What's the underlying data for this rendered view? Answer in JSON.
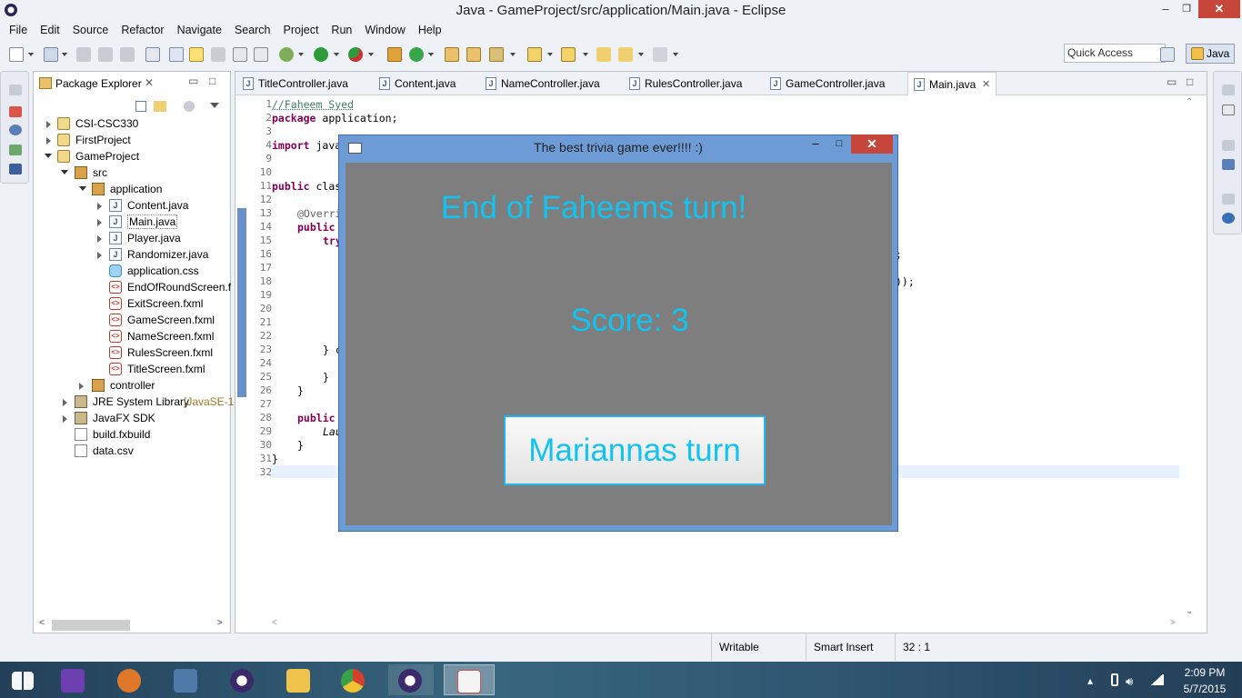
{
  "window": {
    "title": "Java - GameProject/src/application/Main.java - Eclipse",
    "min_glyph": "–",
    "max_glyph": "❐",
    "close_glyph": "✕"
  },
  "menu": [
    "File",
    "Edit",
    "Source",
    "Refactor",
    "Navigate",
    "Search",
    "Project",
    "Run",
    "Window",
    "Help"
  ],
  "toolbar": {
    "quick_access": "Quick Access",
    "perspective": "Java"
  },
  "package_explorer": {
    "title": "Package Explorer",
    "tree": [
      {
        "label": "CSI-CSC330",
        "icon": "project-icon",
        "expanded": false
      },
      {
        "label": "FirstProject",
        "icon": "project-icon",
        "expanded": false
      },
      {
        "label": "GameProject",
        "icon": "project-icon",
        "expanded": true
      },
      {
        "label": "src",
        "icon": "source-folder-icon",
        "expanded": true
      },
      {
        "label": "application",
        "icon": "package-icon",
        "expanded": true
      },
      {
        "label": "Content.java",
        "icon": "java-file-icon",
        "expanded": false
      },
      {
        "label": "Main.java",
        "icon": "java-file-icon",
        "expanded": false
      },
      {
        "label": "Player.java",
        "icon": "java-file-icon",
        "expanded": false
      },
      {
        "label": "Randomizer.java",
        "icon": "java-file-icon",
        "expanded": false
      },
      {
        "label": "application.css",
        "icon": "css-file-icon"
      },
      {
        "label": "EndOfRoundScreen.f",
        "icon": "fxml-file-icon"
      },
      {
        "label": "ExitScreen.fxml",
        "icon": "fxml-file-icon"
      },
      {
        "label": "GameScreen.fxml",
        "icon": "fxml-file-icon"
      },
      {
        "label": "NameScreen.fxml",
        "icon": "fxml-file-icon"
      },
      {
        "label": "RulesScreen.fxml",
        "icon": "fxml-file-icon"
      },
      {
        "label": "TitleScreen.fxml",
        "icon": "fxml-file-icon"
      },
      {
        "label": "controller",
        "icon": "package-icon",
        "expanded": false
      },
      {
        "label": "JRE System Library",
        "decoration": "[JavaSE-1",
        "icon": "library-icon",
        "expanded": false
      },
      {
        "label": "JavaFX SDK",
        "icon": "library-icon",
        "expanded": false
      },
      {
        "label": "build.fxbuild",
        "icon": "file-icon"
      },
      {
        "label": "data.csv",
        "icon": "file-icon"
      }
    ]
  },
  "editor": {
    "tabs": [
      "TitleController.java",
      "Content.java",
      "NameController.java",
      "RulesController.java",
      "GameController.java",
      "Main.java"
    ],
    "active_tab": "Main.java",
    "line_numbers": [
      "1",
      "2",
      "3",
      "4",
      "9",
      "10",
      "11",
      "12",
      "13",
      "14",
      "15",
      "16",
      "17",
      "18",
      "19",
      "20",
      "21",
      "22",
      "23",
      "24",
      "25",
      "26",
      "27",
      "28",
      "29",
      "30",
      "31",
      "32"
    ],
    "code": {
      "l1": "//Faheem Syed",
      "l2_kw": "package",
      "l2_rest": " application;",
      "l4_kw": "import",
      "l4_rest": " java",
      "l11_kw": "public",
      "l11_rest": " clas",
      "l13": "@Overri",
      "l14_kw": "public",
      "l15_kw": "try",
      "l15_tail": ";",
      "l18_tail": "));",
      "l23": "} c",
      "l25": "}",
      "l26": "}",
      "l28_kw": "public",
      "l29": "Lau",
      "l30": "}",
      "l31": "}"
    }
  },
  "status": {
    "writable": "Writable",
    "insert_mode": "Smart Insert",
    "position": "32 : 1"
  },
  "dialog": {
    "title": "The best trivia game ever!!!!  :)",
    "heading": "End of Faheems turn!",
    "score": "Score: 3",
    "button": "Mariannas turn",
    "min_glyph": "–",
    "max_glyph": "□",
    "close_glyph": "✕"
  },
  "taskbar": {
    "time": "2:09 PM",
    "date": "5/7/2015",
    "apps": [
      "windows-start-icon",
      "visual-studio-icon",
      "matlab-icon",
      "intellij-icon",
      "eclipse-icon",
      "file-explorer-icon",
      "chrome-icon",
      "eclipse-icon",
      "java-icon"
    ]
  },
  "colors": {
    "dialog_text": "#12c3ef",
    "dialog_bg": "#7e7e7e",
    "close_red": "#c7463b"
  }
}
